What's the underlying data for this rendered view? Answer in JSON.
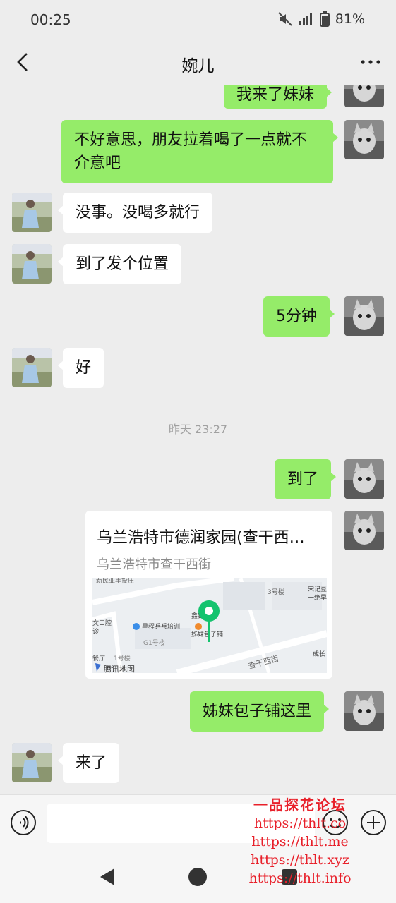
{
  "status_bar": {
    "time": "00:25",
    "battery": "81%"
  },
  "header": {
    "title": "婉儿"
  },
  "messages": [
    {
      "from": "me",
      "text": "我来了妹妹"
    },
    {
      "from": "me",
      "text": "不好意思，朋友拉着喝了一点就不介意吧"
    },
    {
      "from": "them",
      "text": "没事。没喝多就行"
    },
    {
      "from": "them",
      "text": "到了发个位置"
    },
    {
      "from": "me",
      "text": "5分钟"
    },
    {
      "from": "them",
      "text": "好"
    },
    {
      "from": "me",
      "text": "到了"
    },
    {
      "from": "me",
      "text": "姊妹包子铺这里"
    },
    {
      "from": "them",
      "text": "来了"
    }
  ],
  "timestamp": "昨天 23:27",
  "location": {
    "title": "乌兰浩特市德润家园(查干西…",
    "address": "乌兰浩特市查干西街",
    "map_labels": {
      "poi_main": "姊妹包子铺",
      "poi_training": "星程乒乓培训",
      "poi_shop": "鑫锦来",
      "street": "查干西街",
      "bldg_3": "3号楼",
      "bldg_g1": "G1号楼",
      "bldg_1": "1号楼",
      "song": "宋记豆",
      "yige": "一绝早",
      "wenkou": "文口腔",
      "kou": "诊",
      "canting": "餐厅",
      "chengchang": "成长",
      "top": "新民亚丰投庄",
      "logo": "腾讯地图"
    }
  },
  "watermark": {
    "title": "一品探花论坛",
    "lines": [
      "https://thlt.co",
      "https://thlt.me",
      "https://thlt.xyz",
      "https://thlt.info"
    ]
  },
  "colors": {
    "my_bubble": "#95ec69",
    "their_bubble": "#ffffff",
    "background": "#ededed",
    "pin": "#14c36e"
  }
}
